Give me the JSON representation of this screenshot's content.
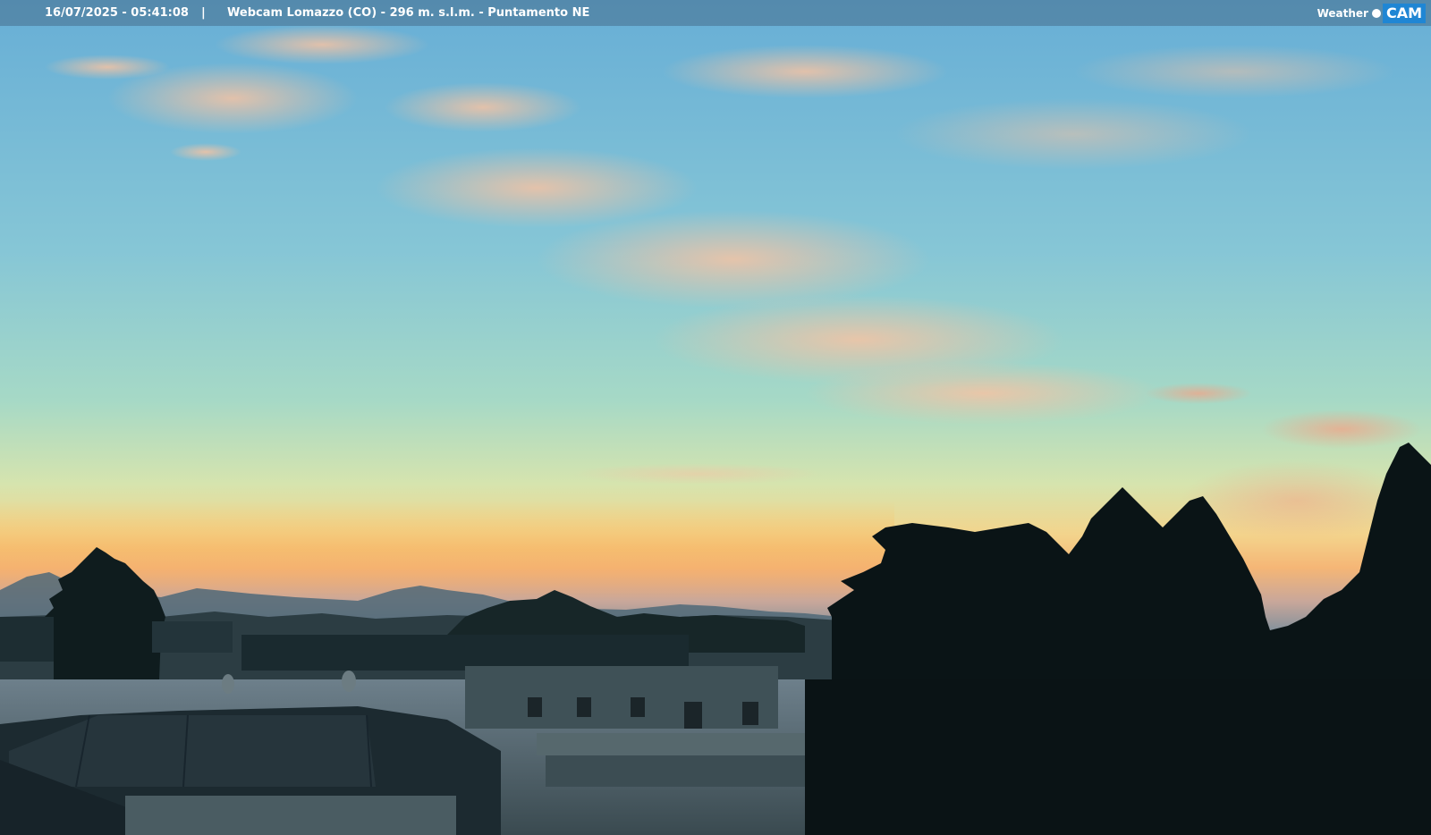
{
  "overlay": {
    "timestamp": "16/07/2025 - 05:41:08",
    "separator": "|",
    "caption": "Webcam Lomazzo (CO) - 296 m. s.l.m. - Puntamento NE"
  },
  "logo": {
    "left_text": "Weather",
    "right_text": "CAM",
    "accent_color": "#1f86d4"
  },
  "scene": {
    "description_colors": {
      "sky_top": "#6fb6d8",
      "sky_mid": "#9fd3c9",
      "horizon": "#f2c878",
      "horizon_glow": "#f0a46a",
      "silhouette": "#0b1517"
    }
  }
}
